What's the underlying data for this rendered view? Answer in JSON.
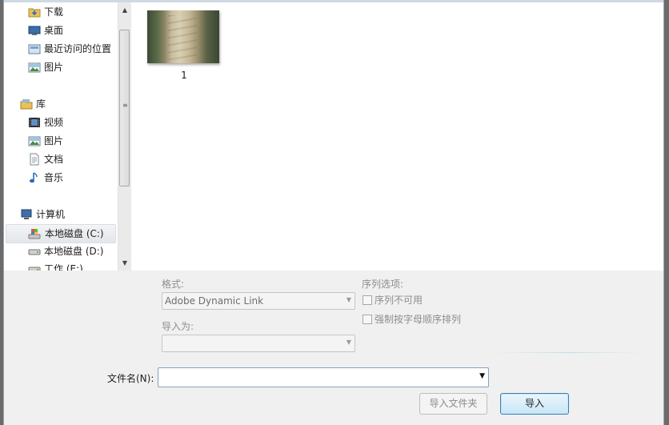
{
  "nav": {
    "items": [
      {
        "label": "下载",
        "icon": "download-folder-icon"
      },
      {
        "label": "桌面",
        "icon": "desktop-icon"
      },
      {
        "label": "最近访问的位置",
        "icon": "recent-places-icon"
      },
      {
        "label": "图片",
        "icon": "pictures-icon"
      },
      {
        "label": "库",
        "icon": "libraries-icon"
      },
      {
        "label": "视频",
        "icon": "videos-icon"
      },
      {
        "label": "图片",
        "icon": "pictures-icon"
      },
      {
        "label": "文档",
        "icon": "documents-icon"
      },
      {
        "label": "音乐",
        "icon": "music-icon"
      },
      {
        "label": "计算机",
        "icon": "computer-icon"
      },
      {
        "label": "本地磁盘 (C:)",
        "icon": "system-drive-icon",
        "selected": true
      },
      {
        "label": "本地磁盘 (D:)",
        "icon": "drive-icon"
      },
      {
        "label": "工作 (E:)",
        "icon": "drive-icon"
      }
    ]
  },
  "files": [
    {
      "name": "1"
    }
  ],
  "options": {
    "format_label": "格式:",
    "format_value": "Adobe Dynamic Link",
    "import_as_label": "导入为:",
    "import_as_value": "",
    "sequence_label": "序列选项:",
    "sequence_unavailable": "序列不可用",
    "force_alpha": "强制按字母顺序排列"
  },
  "filename": {
    "label": "文件名(N):",
    "value": ""
  },
  "buttons": {
    "import_folder": "导入文件夹",
    "import": "导入"
  },
  "colors": {
    "accent": "#3c7fb1",
    "selection": "#e4e7ea",
    "disabled_text": "#8d8d8d"
  }
}
